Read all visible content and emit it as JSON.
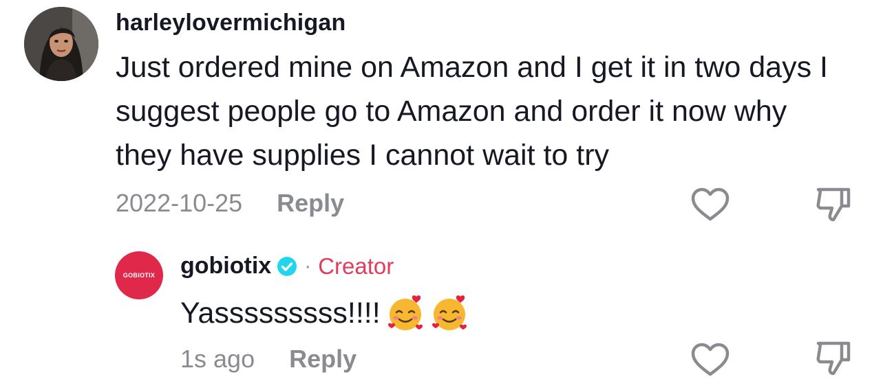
{
  "comment": {
    "username": "harleylovermichigan",
    "text": "Just ordered mine on Amazon and I get it in two days I suggest people go to Amazon and order it now why they have supplies I cannot wait to try",
    "date": "2022-10-25",
    "reply_label": "Reply"
  },
  "reply": {
    "avatar_text": "GOBIOTIX",
    "username": "gobiotix",
    "separator": "·",
    "badge": "Creator",
    "text": "Yasssssssss!!!!",
    "emojis": [
      "smiling-face-with-hearts",
      "smiling-face-with-hearts"
    ],
    "time": "1s ago",
    "reply_label": "Reply"
  },
  "colors": {
    "text": "#161823",
    "muted": "#8a8b91",
    "creator": "#e13d5a",
    "verified": "#20d5ec",
    "brand_avatar": "#e0284a"
  },
  "icons": {
    "like": "heart-outline-icon",
    "dislike": "thumbs-down-outline-icon",
    "verified": "verified-badge-icon"
  }
}
